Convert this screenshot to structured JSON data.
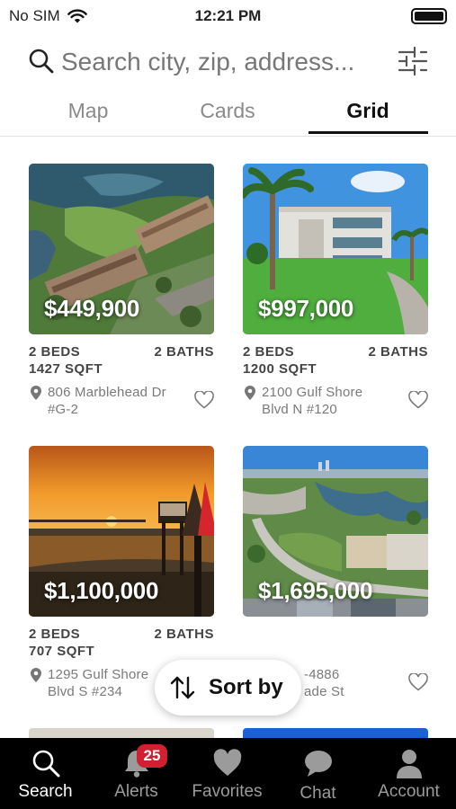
{
  "status": {
    "carrier": "No SIM",
    "time": "12:21 PM"
  },
  "search": {
    "placeholder": "Search city, zip, address..."
  },
  "tabs": [
    {
      "label": "Map",
      "active": false
    },
    {
      "label": "Cards",
      "active": false
    },
    {
      "label": "Grid",
      "active": true
    }
  ],
  "listings": [
    {
      "price": "$449,900",
      "beds": "2 BEDS",
      "baths": "2 BATHS",
      "sqft": "1427 SQFT",
      "address_line1": "806 Marblehead Dr",
      "address_line2": "#G-2",
      "photo": "aerial-golf-condos"
    },
    {
      "price": "$997,000",
      "beds": "2 BEDS",
      "baths": "2 BATHS",
      "sqft": "1200 SQFT",
      "address_line1": "2100 Gulf Shore",
      "address_line2": "Blvd N #120",
      "photo": "white-condo-palms"
    },
    {
      "price": "$1,100,000",
      "beds": "2 BEDS",
      "baths": "2 BATHS",
      "sqft": "707 SQFT",
      "address_line1": "1295 Gulf Shore",
      "address_line2": "Blvd S #234",
      "photo": "sunset-bay"
    },
    {
      "price": "$1,695,000",
      "beds": "",
      "baths": "",
      "sqft": "",
      "address_line1": "-4886",
      "address_line2": "ade St",
      "photo": "aerial-canal-lots"
    }
  ],
  "sort": {
    "label": "Sort by"
  },
  "tab_bar": {
    "items": [
      {
        "label": "Search",
        "icon": "search-icon",
        "active": true
      },
      {
        "label": "Alerts",
        "icon": "bell-icon",
        "active": false
      },
      {
        "label": "Favorites",
        "icon": "heart-icon",
        "active": false
      },
      {
        "label": "Chat",
        "icon": "chat-icon",
        "active": false
      },
      {
        "label": "Account",
        "icon": "person-icon",
        "active": false
      }
    ],
    "alerts_badge": "25"
  },
  "colors": {
    "active_tab_underline": "#111111",
    "badge": "#d1202f",
    "tab_bar_bg": "#000000"
  }
}
